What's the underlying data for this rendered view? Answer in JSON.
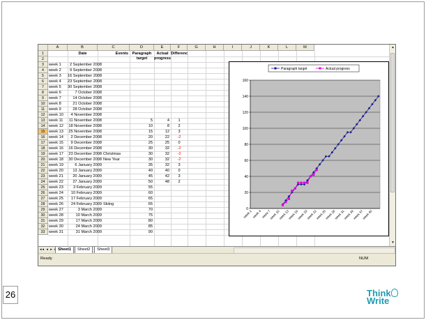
{
  "columns": [
    "A",
    "B",
    "C",
    "D",
    "E",
    "F",
    "G",
    "H",
    "I",
    "J",
    "K",
    "L",
    "M"
  ],
  "headers": {
    "date": "Date",
    "events": "Events",
    "target": [
      "Paragraph",
      "target"
    ],
    "actual": [
      "Actual",
      "progress"
    ],
    "difference": "Difference"
  },
  "rows": [
    {
      "week": "week 1",
      "date": "2 September 2008",
      "event": "",
      "target": "",
      "actual": "",
      "diff": ""
    },
    {
      "week": "week 2",
      "date": "9 September 2008",
      "event": "",
      "target": "",
      "actual": "",
      "diff": ""
    },
    {
      "week": "week 3",
      "date": "16 September 2008",
      "event": "",
      "target": "",
      "actual": "",
      "diff": ""
    },
    {
      "week": "week 4",
      "date": "23 September 2008",
      "event": "",
      "target": "",
      "actual": "",
      "diff": ""
    },
    {
      "week": "week 5",
      "date": "30 September 2008",
      "event": "",
      "target": "",
      "actual": "",
      "diff": ""
    },
    {
      "week": "week 6",
      "date": "7 October 2008",
      "event": "",
      "target": "",
      "actual": "",
      "diff": ""
    },
    {
      "week": "week 7",
      "date": "14 October 2008",
      "event": "",
      "target": "",
      "actual": "",
      "diff": ""
    },
    {
      "week": "week 8",
      "date": "21 October 2008",
      "event": "",
      "target": "",
      "actual": "",
      "diff": ""
    },
    {
      "week": "week 9",
      "date": "28 October 2008",
      "event": "",
      "target": "",
      "actual": "",
      "diff": ""
    },
    {
      "week": "week 10",
      "date": "4 November 2008",
      "event": "",
      "target": "",
      "actual": "",
      "diff": ""
    },
    {
      "week": "week 11",
      "date": "11 November 2008",
      "event": "",
      "target": "5",
      "actual": "4",
      "diff": "1"
    },
    {
      "week": "week 12",
      "date": "18 November 2008",
      "event": "",
      "target": "10",
      "actual": "8",
      "diff": "2"
    },
    {
      "week": "week 13",
      "date": "25 November 2008",
      "event": "",
      "target": "15",
      "actual": "12",
      "diff": "3"
    },
    {
      "week": "week 14",
      "date": "2 December 2008",
      "event": "",
      "target": "20",
      "actual": "22",
      "diff": "-2"
    },
    {
      "week": "week 15",
      "date": "9 December 2008",
      "event": "",
      "target": "25",
      "actual": "25",
      "diff": "0"
    },
    {
      "week": "week 16",
      "date": "16 December 2008",
      "event": "",
      "target": "30",
      "actual": "32",
      "diff": "-2"
    },
    {
      "week": "week 17",
      "date": "23 December 2008",
      "event": "Christmas",
      "target": "30",
      "actual": "32",
      "diff": "-2"
    },
    {
      "week": "week 18",
      "date": "30 December 2008",
      "event": "New Year",
      "target": "30",
      "actual": "32",
      "diff": "-2"
    },
    {
      "week": "week 19",
      "date": "6 January 2009",
      "event": "",
      "target": "35",
      "actual": "32",
      "diff": "3"
    },
    {
      "week": "week 20",
      "date": "13 January 2009",
      "event": "",
      "target": "40",
      "actual": "40",
      "diff": "0"
    },
    {
      "week": "week 21",
      "date": "20 January 2009",
      "event": "",
      "target": "45",
      "actual": "42",
      "diff": "3"
    },
    {
      "week": "week 22",
      "date": "27 January 2009",
      "event": "",
      "target": "50",
      "actual": "48",
      "diff": "2"
    },
    {
      "week": "week 23",
      "date": "3 February 2009",
      "event": "",
      "target": "55",
      "actual": "",
      "diff": ""
    },
    {
      "week": "week 24",
      "date": "10 February 2009",
      "event": "",
      "target": "60",
      "actual": "",
      "diff": ""
    },
    {
      "week": "week 25",
      "date": "17 February 2009",
      "event": "",
      "target": "65",
      "actual": "",
      "diff": ""
    },
    {
      "week": "week 26",
      "date": "24 February 2009",
      "event": "Skiing",
      "target": "65",
      "actual": "",
      "diff": ""
    },
    {
      "week": "week 27",
      "date": "3 March 2009",
      "event": "",
      "target": "70",
      "actual": "",
      "diff": ""
    },
    {
      "week": "week 28",
      "date": "10 March 2009",
      "event": "",
      "target": "75",
      "actual": "",
      "diff": ""
    },
    {
      "week": "week 29",
      "date": "17 March 2009",
      "event": "",
      "target": "80",
      "actual": "",
      "diff": ""
    },
    {
      "week": "week 30",
      "date": "24 March 2009",
      "event": "",
      "target": "85",
      "actual": "",
      "diff": ""
    },
    {
      "week": "week 31",
      "date": "31 March 2009",
      "event": "",
      "target": "90",
      "actual": "",
      "diff": ""
    }
  ],
  "selected_row": "15",
  "sheet_tabs": [
    "Sheet1",
    "Sheet2",
    "Sheet3"
  ],
  "active_tab": "Sheet1",
  "status": {
    "left": "Ready",
    "right": "NUM"
  },
  "slide_number": "26",
  "logo": [
    "Think",
    "Write"
  ],
  "colors": {
    "target": "#1a1a8c",
    "actual": "#e000e0",
    "plot_bg": "#c0c0c0",
    "logo": "#1f9bb0"
  },
  "chart_data": {
    "type": "line",
    "legend_position": "top",
    "ylim": [
      0,
      160
    ],
    "yticks": [
      0,
      20,
      40,
      60,
      80,
      100,
      120,
      140,
      160
    ],
    "xtick_labels": [
      "week 1",
      "week 4",
      "week 7",
      "week 10",
      "week 13",
      "week 16",
      "week 19",
      "week 22",
      "week 25",
      "week 28",
      "week 31",
      "week 34",
      "week 37",
      "week 40"
    ],
    "series": [
      {
        "name": "Paragraph target",
        "color": "#1a1a8c",
        "marker": "diamond",
        "start_index": 10,
        "values": [
          5,
          10,
          15,
          20,
          25,
          30,
          30,
          30,
          35,
          40,
          45,
          50,
          55,
          60,
          65,
          65,
          70,
          75,
          80,
          85,
          90,
          95,
          95,
          100,
          105,
          110,
          115,
          120,
          125,
          130,
          135,
          140
        ]
      },
      {
        "name": "Actual progress",
        "color": "#e000e0",
        "marker": "square",
        "start_index": 10,
        "values": [
          4,
          8,
          12,
          22,
          25,
          32,
          32,
          32,
          32,
          40,
          42,
          48
        ]
      }
    ]
  }
}
